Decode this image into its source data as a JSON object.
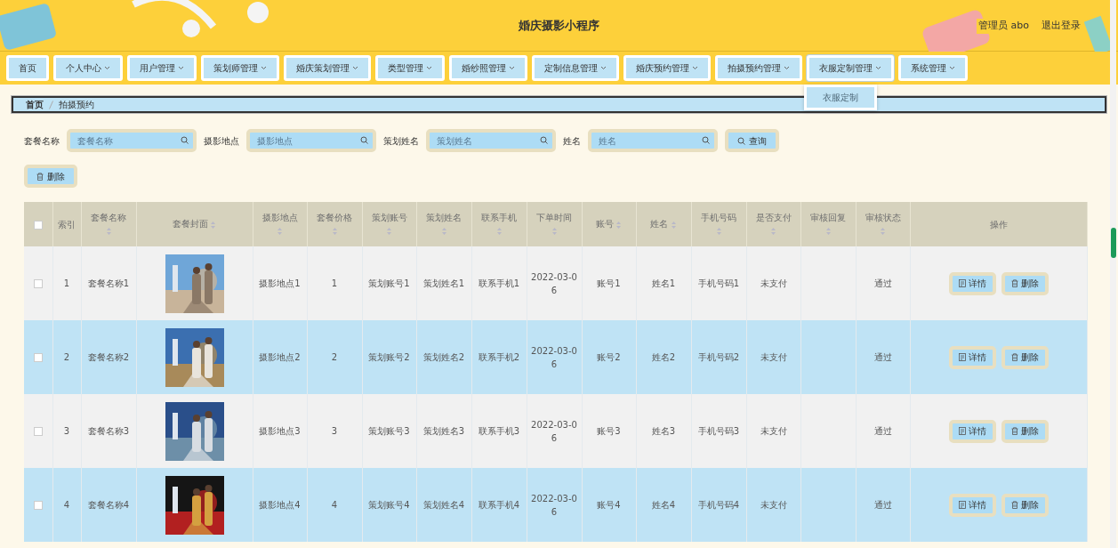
{
  "header": {
    "title": "婚庆摄影小程序",
    "user": "管理员 abo",
    "logout": "退出登录"
  },
  "nav": [
    {
      "label": "首页",
      "kind": "link",
      "expanded": false
    },
    {
      "label": "个人中心",
      "kind": "menu",
      "expanded": false
    },
    {
      "label": "用户管理",
      "kind": "menu",
      "expanded": false
    },
    {
      "label": "策划师管理",
      "kind": "menu",
      "expanded": false
    },
    {
      "label": "婚庆策划管理",
      "kind": "menu",
      "expanded": false
    },
    {
      "label": "类型管理",
      "kind": "menu",
      "expanded": false
    },
    {
      "label": "婚纱照管理",
      "kind": "menu",
      "expanded": false
    },
    {
      "label": "定制信息管理",
      "kind": "menu",
      "expanded": false
    },
    {
      "label": "婚庆预约管理",
      "kind": "menu",
      "expanded": false
    },
    {
      "label": "拍摄预约管理",
      "kind": "menu",
      "expanded": false
    },
    {
      "label": "衣服定制管理",
      "kind": "menu",
      "expanded": true,
      "menu": [
        "衣服定制"
      ]
    },
    {
      "label": "系统管理",
      "kind": "menu",
      "expanded": false
    }
  ],
  "breadcrumb": [
    "首页",
    "拍摄预约"
  ],
  "filters": [
    {
      "label": "套餐名称",
      "placeholder": "套餐名称"
    },
    {
      "label": "摄影地点",
      "placeholder": "摄影地点"
    },
    {
      "label": "策划姓名",
      "placeholder": "策划姓名"
    },
    {
      "label": "姓名",
      "placeholder": "姓名"
    }
  ],
  "search_button": "查询",
  "bulk_delete": "删除",
  "table": {
    "select_all": {
      "checked": false
    },
    "columns": [
      {
        "kind": "check"
      },
      {
        "label": "索引",
        "kind": "plain"
      },
      {
        "label": "套餐名称",
        "kind": "sort-below"
      },
      {
        "label": "套餐封面",
        "kind": "sort-inline"
      },
      {
        "label": "摄影地点",
        "kind": "sort-below"
      },
      {
        "label": "套餐价格",
        "kind": "sort-below"
      },
      {
        "label": "策划账号",
        "kind": "sort-below"
      },
      {
        "label": "策划姓名",
        "kind": "sort-below"
      },
      {
        "label": "联系手机",
        "kind": "sort-below"
      },
      {
        "label": "下单时间",
        "kind": "sort-below"
      },
      {
        "label": "账号",
        "kind": "sort-inline"
      },
      {
        "label": "姓名",
        "kind": "sort-inline"
      },
      {
        "label": "手机号码",
        "kind": "sort-below"
      },
      {
        "label": "是否支付",
        "kind": "sort-below"
      },
      {
        "label": "审核回复",
        "kind": "sort-below"
      },
      {
        "label": "审核状态",
        "kind": "sort-below"
      },
      {
        "label": "操作",
        "kind": "plain"
      }
    ],
    "rows": [
      {
        "selected": false,
        "index": "1",
        "package_name": "套餐名称1",
        "location": "摄影地点1",
        "price": "1",
        "planner_account": "策划账号1",
        "planner_name": "策划姓名1",
        "contact_phone": "联系手机1",
        "order_time": "2022-03-06",
        "account": "账号1",
        "name": "姓名1",
        "phone": "手机号码1",
        "paid": "未支付",
        "review_status": "通过",
        "actions": [
          {
            "label": "详情",
            "kind": "detail"
          },
          {
            "label": "删除",
            "kind": "delete"
          }
        ]
      },
      {
        "selected": false,
        "index": "2",
        "package_name": "套餐名称2",
        "location": "摄影地点2",
        "price": "2",
        "planner_account": "策划账号2",
        "planner_name": "策划姓名2",
        "contact_phone": "联系手机2",
        "order_time": "2022-03-06",
        "account": "账号2",
        "name": "姓名2",
        "phone": "手机号码2",
        "paid": "未支付",
        "review_status": "通过",
        "actions": [
          {
            "label": "详情",
            "kind": "detail"
          },
          {
            "label": "删除",
            "kind": "delete"
          }
        ]
      },
      {
        "selected": false,
        "index": "3",
        "package_name": "套餐名称3",
        "location": "摄影地点3",
        "price": "3",
        "planner_account": "策划账号3",
        "planner_name": "策划姓名3",
        "contact_phone": "联系手机3",
        "order_time": "2022-03-06",
        "account": "账号3",
        "name": "姓名3",
        "phone": "手机号码3",
        "paid": "未支付",
        "review_status": "通过",
        "actions": [
          {
            "label": "详情",
            "kind": "detail"
          },
          {
            "label": "删除",
            "kind": "delete"
          }
        ]
      },
      {
        "selected": false,
        "index": "4",
        "package_name": "套餐名称4",
        "location": "摄影地点4",
        "price": "4",
        "planner_account": "策划账号4",
        "planner_name": "策划姓名4",
        "contact_phone": "联系手机4",
        "order_time": "2022-03-06",
        "account": "账号4",
        "name": "姓名4",
        "phone": "手机号码4",
        "paid": "未支付",
        "review_status": "通过",
        "actions": [
          {
            "label": "详情",
            "kind": "detail"
          },
          {
            "label": "删除",
            "kind": "delete"
          }
        ]
      }
    ]
  }
}
